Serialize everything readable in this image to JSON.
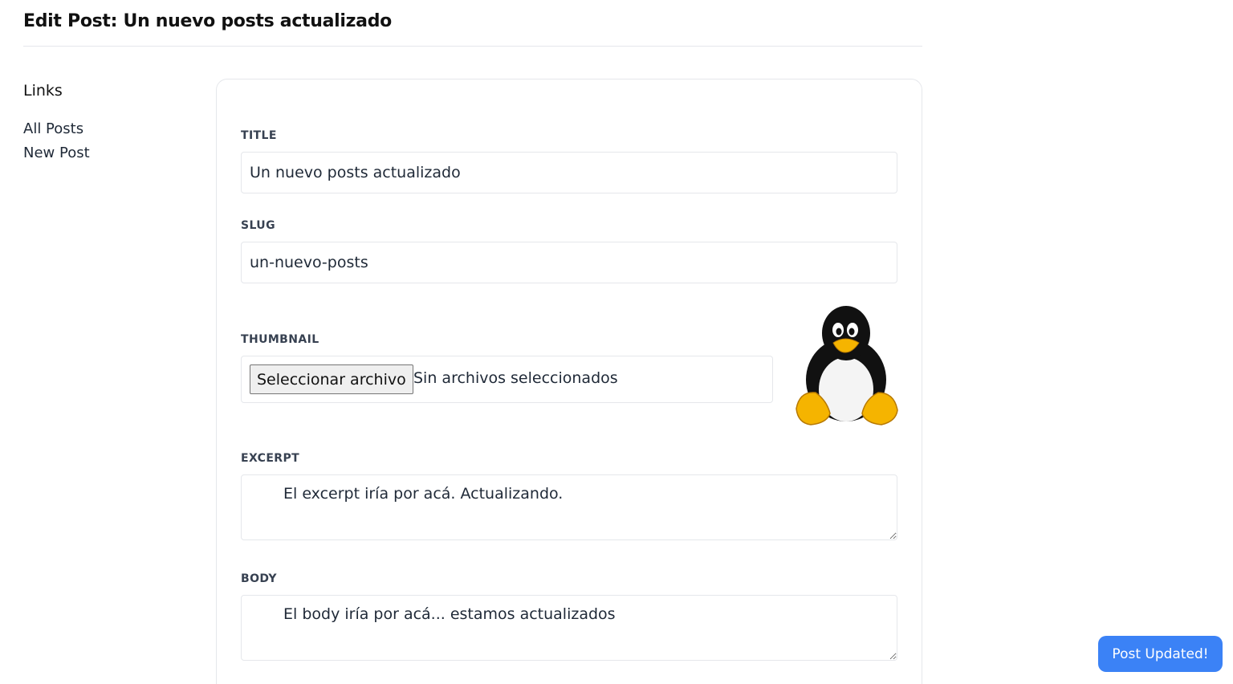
{
  "header": {
    "title": "Edit Post: Un nuevo posts actualizado"
  },
  "sidebar": {
    "heading": "Links",
    "links": [
      {
        "label": "All Posts"
      },
      {
        "label": "New Post"
      }
    ]
  },
  "form": {
    "title": {
      "label": "TITLE",
      "value": "Un nuevo posts actualizado"
    },
    "slug": {
      "label": "SLUG",
      "value": "un-nuevo-posts"
    },
    "thumbnail": {
      "label": "THUMBNAIL",
      "button_label": "Seleccionar archivo",
      "status": "Sin archivos seleccionados",
      "preview_icon": "tux-penguin-icon"
    },
    "excerpt": {
      "label": "EXCERPT",
      "value": "El excerpt iría por acá. Actualizando."
    },
    "body": {
      "label": "BODY",
      "value": "El body iría por acá... estamos actualizados"
    }
  },
  "toast": {
    "message": "Post Updated!",
    "color": "#3b82f6"
  }
}
